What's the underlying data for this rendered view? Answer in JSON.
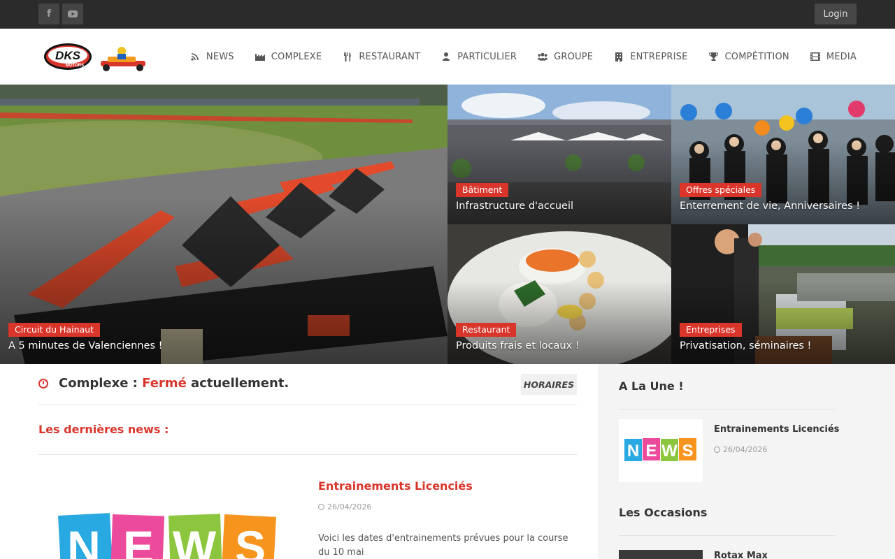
{
  "topbar": {
    "social": [
      {
        "icon": "facebook-icon",
        "glyph": "f"
      },
      {
        "icon": "youtube-icon",
        "glyph": "▶"
      }
    ],
    "login_label": "Login"
  },
  "header": {
    "logo_text": "DKS",
    "logo_subtext": "MOTORS",
    "nav": [
      {
        "label": "NEWS",
        "icon": "rss-icon"
      },
      {
        "label": "COMPLEXE",
        "icon": "factory-icon"
      },
      {
        "label": "RESTAURANT",
        "icon": "cutlery-icon"
      },
      {
        "label": "PARTICULIER",
        "icon": "user-icon"
      },
      {
        "label": "GROUPE",
        "icon": "group-icon"
      },
      {
        "label": "ENTREPRISE",
        "icon": "building-icon"
      },
      {
        "label": "COMPÉTITION",
        "icon": "trophy-icon"
      },
      {
        "label": "MEDIA",
        "icon": "film-icon"
      }
    ]
  },
  "hero": [
    {
      "badge": "Circuit du Hainaut",
      "caption": "A 5 minutes de Valenciennes !"
    },
    {
      "badge": "Bâtiment",
      "caption": "Infrastructure d'accueil"
    },
    {
      "badge": "Offres spéciales",
      "caption": "Enterrement de vie, Anniversaires !"
    },
    {
      "badge": "Restaurant",
      "caption": "Produits frais et locaux !"
    },
    {
      "badge": "Entreprises",
      "caption": "Privatisation, séminaires !"
    }
  ],
  "status": {
    "prefix": "Complexe : ",
    "state": "Fermé",
    "suffix": " actuellement.",
    "horaires_label": "HORAIRES"
  },
  "news": {
    "heading": "Les dernières news :",
    "items": [
      {
        "title": "Entrainements Licenciés",
        "date": "26/04/2026",
        "excerpt": "Voici les dates d'entrainements prévues pour la course du 10 mai"
      }
    ]
  },
  "sidebar": {
    "a_la_une_heading": "A La Une !",
    "a_la_une": {
      "title": "Entrainements Licenciés",
      "date": "26/04/2026"
    },
    "occasions_heading": "Les Occasions",
    "occasion": {
      "title": "Rotax Max"
    }
  },
  "colors": {
    "accent": "#d9352a",
    "topbar": "#2b2b2b",
    "sidebar_bg": "#f4f4f4"
  }
}
